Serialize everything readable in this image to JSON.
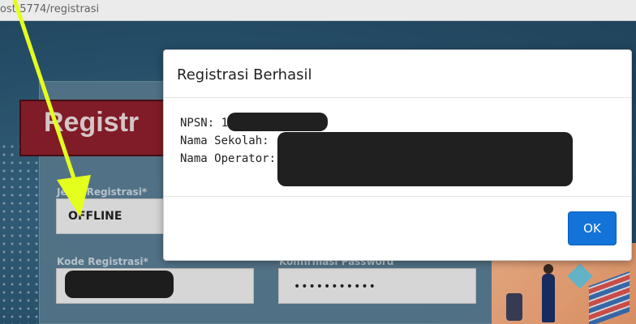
{
  "browser": {
    "url": "ost:5774/registrasi"
  },
  "form": {
    "heading": "Registr",
    "jenis_label": "Jenis Registrasi*",
    "jenis_value": "OFFLINE",
    "kode_label": "Kode Registrasi*",
    "konfirmasi_label": "Konfirmasi Password",
    "password_value": "•••••••••••"
  },
  "modal": {
    "title": "Registrasi Berhasil",
    "npsn_label": "NPSN: 1",
    "sekolah_label": "Nama Sekolah:",
    "operator_label": "Nama Operator:",
    "ok_label": "OK"
  },
  "colors": {
    "annotation_arrow": "#e4ff1e",
    "ok_button": "#1373d9",
    "ribbon": "#8a1f2b"
  }
}
